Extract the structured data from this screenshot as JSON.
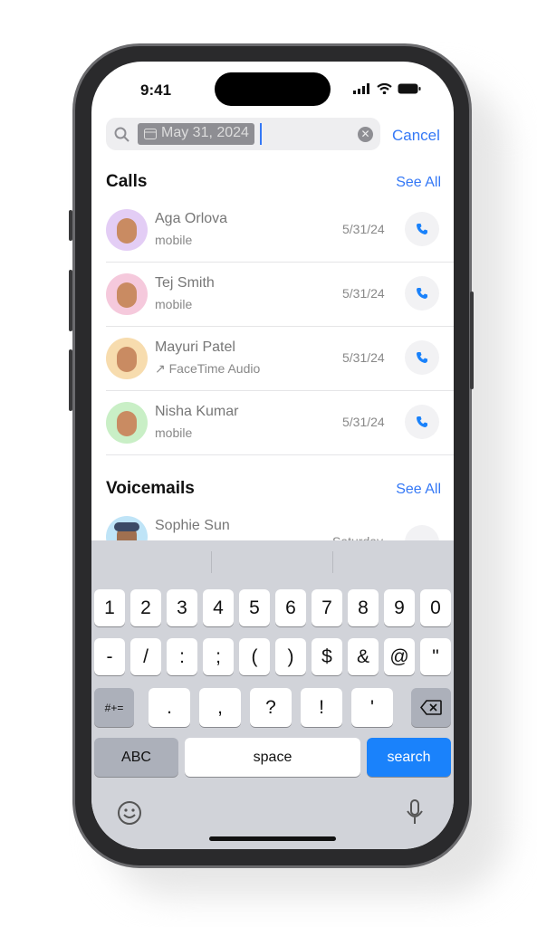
{
  "status": {
    "time": "9:41"
  },
  "search": {
    "value": "May 31, 2024",
    "cancel_label": "Cancel"
  },
  "calls": {
    "title": "Calls",
    "see_all": "See All",
    "items": [
      {
        "name": "Aga Orlova",
        "subtitle": "mobile",
        "date": "5/31/24",
        "avatar_color": "#e3cdf5"
      },
      {
        "name": "Tej Smith",
        "subtitle": "mobile",
        "date": "5/31/24",
        "avatar_color": "#f5c9dc"
      },
      {
        "name": "Mayuri Patel",
        "subtitle": "↗ FaceTime Audio",
        "date": "5/31/24",
        "avatar_color": "#f7dcae"
      },
      {
        "name": "Nisha Kumar",
        "subtitle": "mobile",
        "date": "5/31/24",
        "avatar_color": "#c9efc6"
      }
    ]
  },
  "voicemails": {
    "title": "Voicemails",
    "see_all": "See All",
    "items": [
      {
        "name": "Sophie Sun",
        "date": "Saturday",
        "avatar_color": "#bfe4f7"
      }
    ]
  },
  "keyboard": {
    "row1": [
      "1",
      "2",
      "3",
      "4",
      "5",
      "6",
      "7",
      "8",
      "9",
      "0"
    ],
    "row2": [
      "-",
      "/",
      ":",
      ";",
      "(",
      ")",
      "$",
      "&",
      "@",
      "\""
    ],
    "row3": [
      ".",
      ",",
      "?",
      "!",
      "'"
    ],
    "symbols_label": "#+=",
    "abc_label": "ABC",
    "space_label": "space",
    "search_label": "search",
    "accent": "#1a82fb"
  }
}
